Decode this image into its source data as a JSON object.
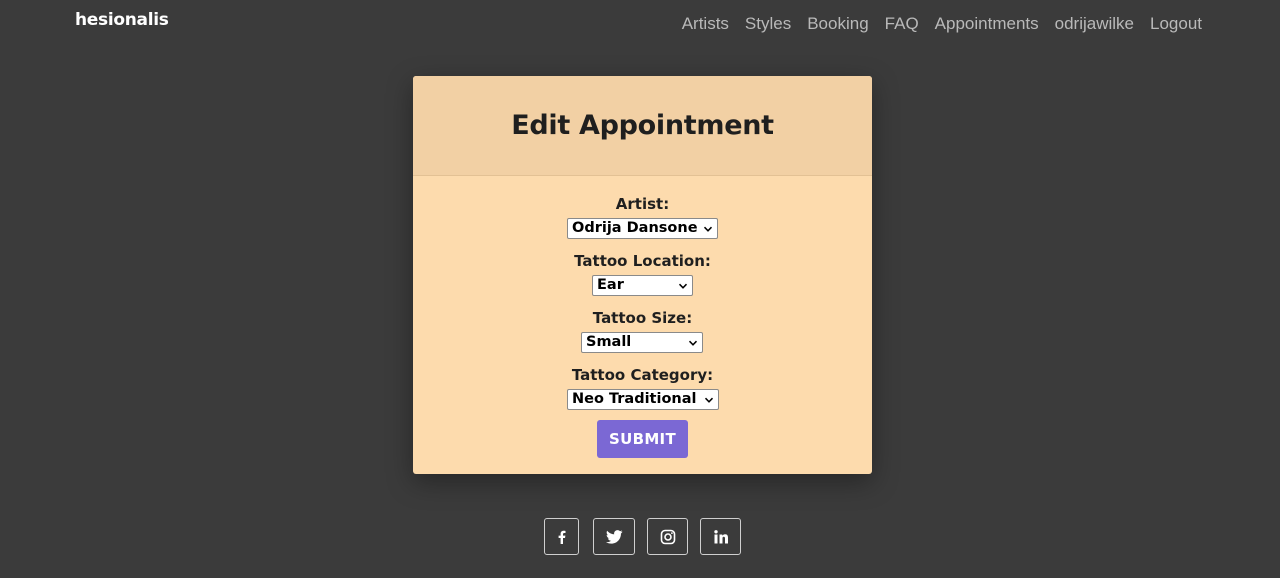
{
  "header": {
    "brand": "hesionalis",
    "nav": [
      "Artists",
      "Styles",
      "Booking",
      "FAQ",
      "Appointments",
      "odrijawilke",
      "Logout"
    ]
  },
  "card": {
    "title": "Edit Appointment",
    "fields": [
      {
        "label": "Artist:",
        "value": "Odrija Dansone"
      },
      {
        "label": "Tattoo Location:",
        "value": "Ear"
      },
      {
        "label": "Tattoo Size:",
        "value": "Small"
      },
      {
        "label": "Tattoo Category:",
        "value": "Neo Traditional"
      }
    ],
    "submit_label": "SUBMIT"
  },
  "footer": {
    "socials": [
      "facebook-icon",
      "twitter-icon",
      "instagram-icon",
      "linkedin-icon"
    ]
  },
  "colors": {
    "background": "#3b3b3b",
    "card_header": "#f2d0a4",
    "card_body": "#fddbad",
    "submit_button": "#7b68d4"
  }
}
